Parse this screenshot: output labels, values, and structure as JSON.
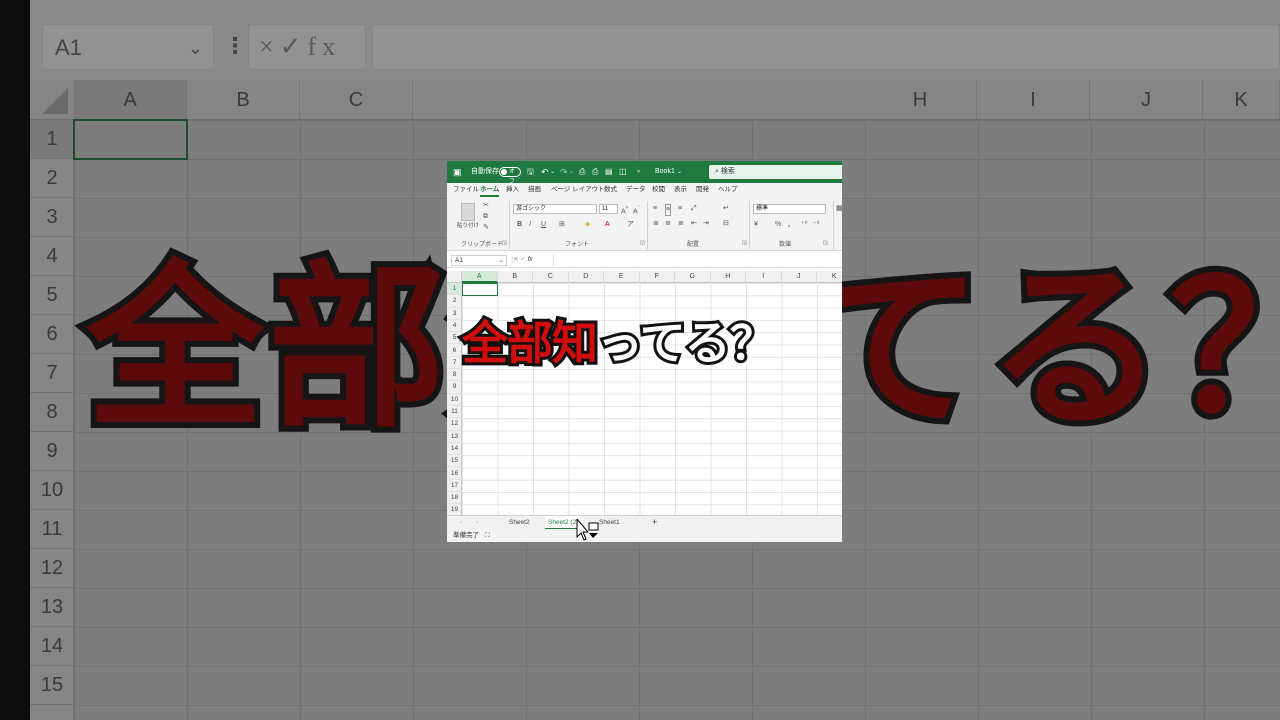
{
  "background": {
    "namebox": "A1",
    "fx_label": "×✓fx",
    "columns": [
      "A",
      "B",
      "C",
      "",
      "",
      "",
      "",
      "",
      "H",
      "I",
      "J",
      "K"
    ],
    "rows": [
      "1",
      "2",
      "3",
      "4",
      "5",
      "6",
      "7",
      "8",
      "9",
      "10",
      "11",
      "12",
      "13",
      "14",
      "15"
    ],
    "overlay_text": "全部知ってる？"
  },
  "excel": {
    "autosave_label": "自動保存",
    "autosave_state": "オフ",
    "book_title": "Book1",
    "search_placeholder": "検索",
    "menu": [
      "ファイル",
      "ホーム",
      "挿入",
      "描画",
      "ページ レイアウト",
      "数式",
      "データ",
      "校閲",
      "表示",
      "開発",
      "ヘルプ"
    ],
    "active_menu_index": 1,
    "ribbon": {
      "paste_label": "貼り付け",
      "clipboard_group": "クリップボード",
      "font_name": "游ゴシック",
      "font_size": "11",
      "font_group": "フォント",
      "align_group": "配置",
      "number_format": "標準",
      "number_group": "数値",
      "bold": "B",
      "italic": "I",
      "underline": "U"
    },
    "namebox": "A1",
    "fx": "fx",
    "columns": [
      "A",
      "B",
      "C",
      "D",
      "E",
      "F",
      "G",
      "H",
      "I",
      "J",
      "K"
    ],
    "rows": [
      "1",
      "2",
      "3",
      "4",
      "5",
      "6",
      "7",
      "8",
      "9",
      "10",
      "11",
      "12",
      "13",
      "14",
      "15",
      "16",
      "17",
      "18",
      "19"
    ],
    "sheet_tabs": [
      "Sheet2",
      "Sheet2 (2)",
      "Sheet1"
    ],
    "active_tab_index": 1,
    "add_sheet": "+",
    "status_ready": "準備完了",
    "status_icon": "accessibility-icon"
  },
  "caption": {
    "red": "全部知",
    "white": "ってる？"
  },
  "colors": {
    "excel_green": "#1f7a3f",
    "caption_red": "#d10d0d"
  }
}
